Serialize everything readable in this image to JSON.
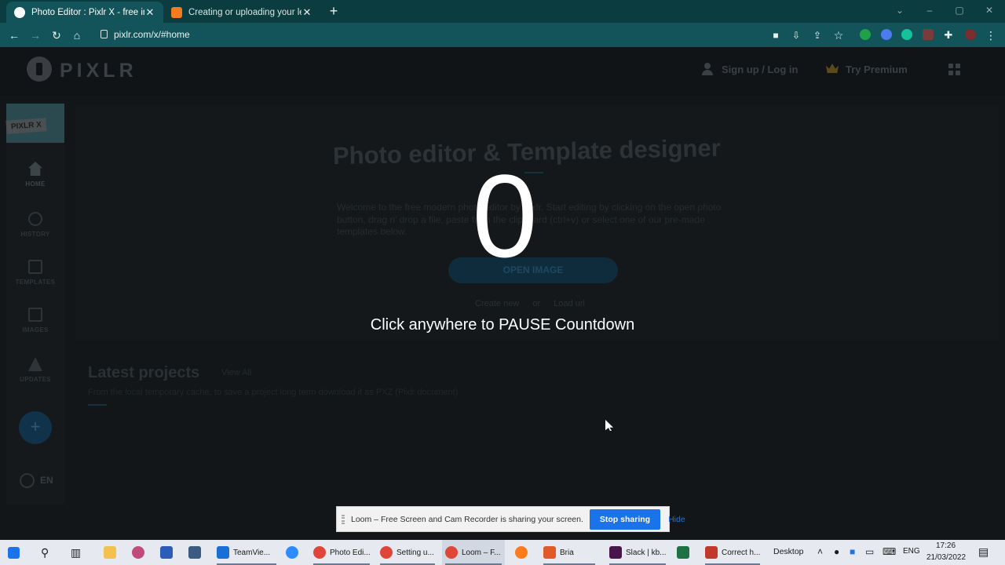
{
  "browser": {
    "tabs": [
      {
        "title": "Photo Editor : Pixlr X - free image editing",
        "active": true,
        "favicon_color": "#ffffff"
      },
      {
        "title": "Creating or uploading your letterhead",
        "active": false,
        "favicon_color": "#f47b20"
      }
    ],
    "new_tab_icon": "plus-icon",
    "url": "pixlr.com/x/#home"
  },
  "pixlr": {
    "logo": "PIXLR",
    "header": {
      "signup_label": "Sign up / Log in",
      "premium_label": "Try Premium"
    },
    "sidebar": {
      "badge": "PIXLR X",
      "items": [
        {
          "label": "HOME",
          "icon": "home-icon"
        },
        {
          "label": "HISTORY",
          "icon": "history-icon"
        },
        {
          "label": "TEMPLATES",
          "icon": "templates-icon"
        },
        {
          "label": "IMAGES",
          "icon": "images-icon"
        },
        {
          "label": "UPDATES",
          "icon": "updates-icon"
        }
      ],
      "add_label": "+",
      "language": "EN"
    },
    "hero": {
      "title": "Photo editor & Template designer",
      "description": "Welcome to the free modern photo editor by Pixlr. Start editing by clicking on the open photo button, drag n' drop a file, paste from the clipboard (ctrl+v) or select one of our pre-made templates below.",
      "open_button": "OPEN IMAGE",
      "create_new": "Create new",
      "or": "or",
      "load_url": "Load url"
    },
    "latest": {
      "title": "Latest projects",
      "view_all": "View All",
      "description": "From the local temporary cache, to save a project long term download it as PXZ (Pixlr document)"
    }
  },
  "overlay": {
    "countdown": "0",
    "instruction": "Click anywhere to PAUSE Countdown"
  },
  "loom": {
    "message": "Loom – Free Screen and Cam Recorder is sharing your screen.",
    "stop_label": "Stop sharing",
    "hide_label": "Hide"
  },
  "taskbar": {
    "items": [
      {
        "label": "TeamVie...",
        "color": "#1a6fd6"
      },
      {
        "label": "Photo Edi...",
        "color": "#e0453a"
      },
      {
        "label": "Setting u...",
        "color": "#e0453a"
      },
      {
        "label": "Loom – F...",
        "color": "#e0453a"
      },
      {
        "label": "Bria",
        "color": "#e05a2a"
      },
      {
        "label": "Slack | kb...",
        "color": "#4a154b"
      },
      {
        "label": "Correct h...",
        "color": "#c0392b"
      }
    ],
    "desktop_label": "Desktop",
    "language": "ENG",
    "time": "17:26",
    "date": "21/03/2022"
  }
}
